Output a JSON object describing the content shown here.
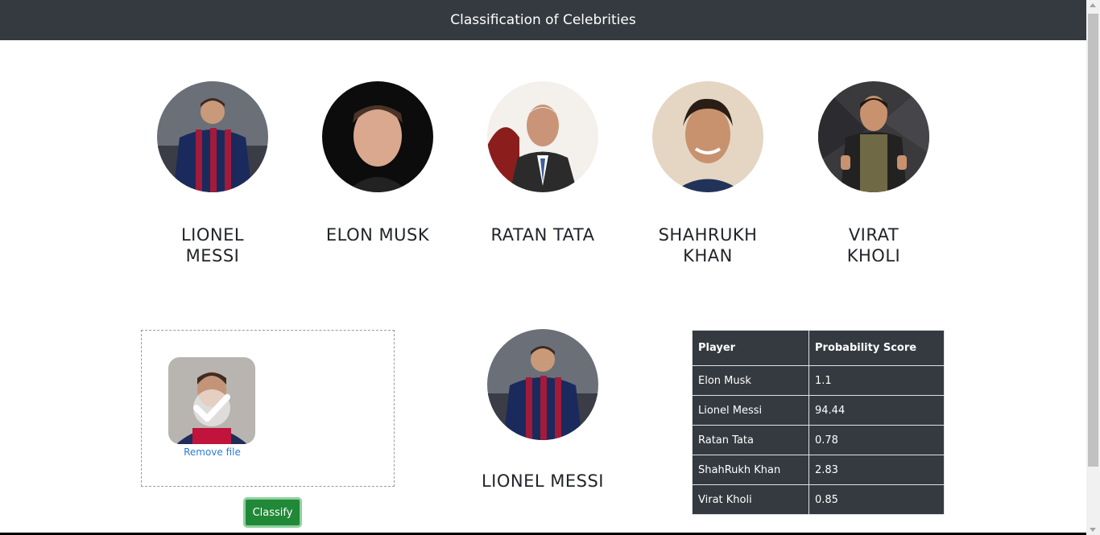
{
  "header": {
    "title": "Classification of Celebrities"
  },
  "celebrities": [
    {
      "name": "LIONEL MESSI",
      "icon": "messi-photo"
    },
    {
      "name": "ELON MUSK",
      "icon": "musk-photo"
    },
    {
      "name": "RATAN TATA",
      "icon": "tata-photo"
    },
    {
      "name": "SHAHRUKH KHAN",
      "icon": "srk-photo"
    },
    {
      "name": "VIRAT KHOLI",
      "icon": "kohli-photo"
    }
  ],
  "upload": {
    "remove_label": "Remove file",
    "classify_label": "Classify"
  },
  "result": {
    "name": "LIONEL MESSI"
  },
  "scores": {
    "headers": [
      "Player",
      "Probability Score"
    ],
    "rows": [
      [
        "Elon Musk",
        "1.1"
      ],
      [
        "Lionel Messi",
        "94.44"
      ],
      [
        "Ratan Tata",
        "0.78"
      ],
      [
        "ShahRukh Khan",
        "2.83"
      ],
      [
        "Virat Kholi",
        "0.85"
      ]
    ]
  },
  "colors": {
    "navbar": "#343a40",
    "button": "#218838",
    "link": "#2d7bd4"
  }
}
